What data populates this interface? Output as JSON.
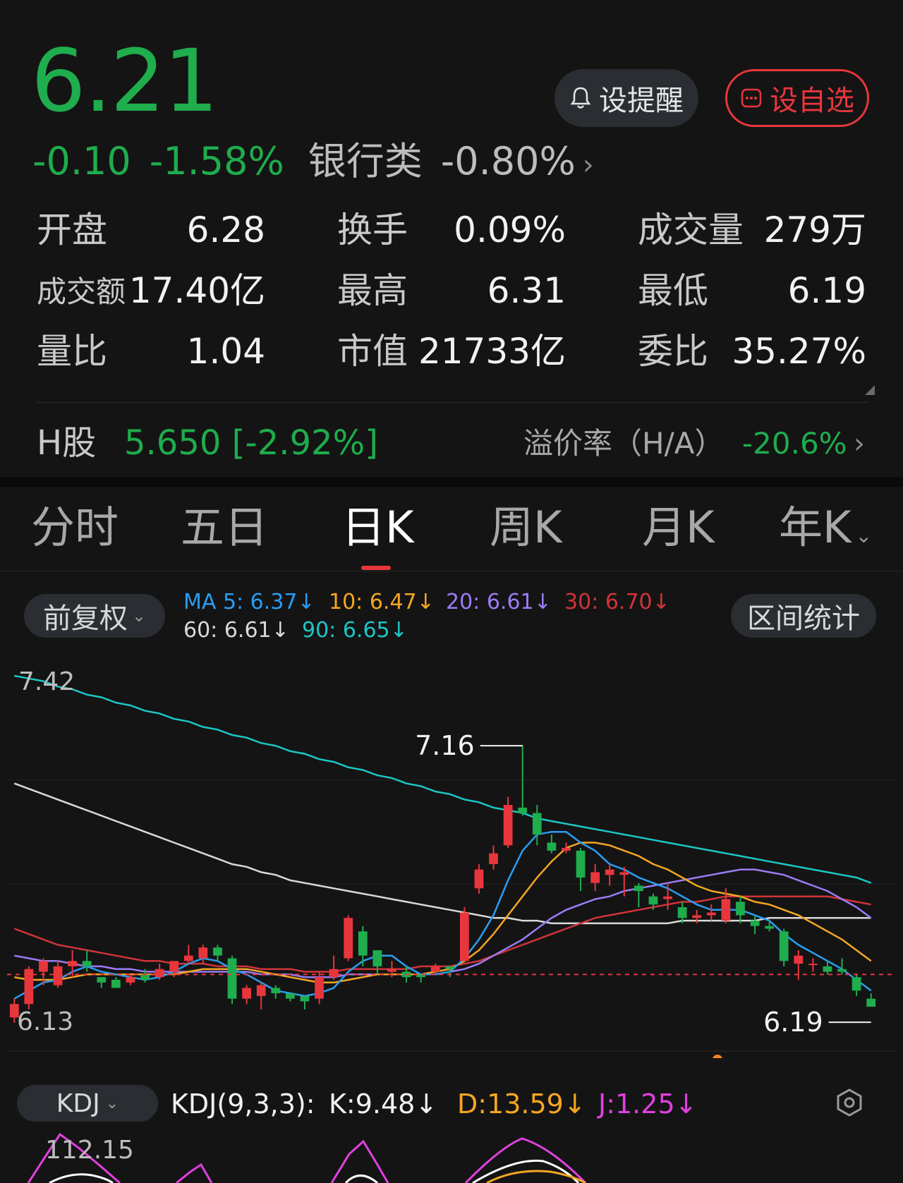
{
  "quote": {
    "price": "6.21",
    "change": "-0.10",
    "change_pct": "-1.58%",
    "sector_name": "银行类",
    "sector_change": "-0.80%",
    "remind_button": "设提醒",
    "watchlist_button": "设自选",
    "stats": {
      "open_label": "开盘",
      "open_value": "6.28",
      "turnover_label": "换手",
      "turnover_value": "0.09%",
      "volume_label": "成交量",
      "volume_value": "279万",
      "amount_label": "成交额",
      "amount_value": "17.40亿",
      "high_label": "最高",
      "high_value": "6.31",
      "low_label": "最低",
      "low_value": "6.19",
      "volume_ratio_label": "量比",
      "volume_ratio_value": "1.04",
      "market_cap_label": "市值",
      "market_cap_value": "21733亿",
      "order_ratio_label": "委比",
      "order_ratio_value": "35.27%"
    },
    "h_share": {
      "label": "H股",
      "value": "5.650 [-2.92%]",
      "premium_label": "溢价率（H/A）",
      "premium_value": "-20.6%"
    }
  },
  "tabs": [
    {
      "label": "分时",
      "active": false
    },
    {
      "label": "五日",
      "active": false
    },
    {
      "label": "日K",
      "active": true
    },
    {
      "label": "周K",
      "active": false
    },
    {
      "label": "月K",
      "active": false
    },
    {
      "label": "年K",
      "active": false
    }
  ],
  "chart_controls": {
    "adjust_label": "前复权",
    "range_stats_label": "区间统计"
  },
  "ma_legend": {
    "ma5": "MA 5: 6.37↓",
    "ma10": "10: 6.47↓",
    "ma20": "20: 6.61↓",
    "ma30": "30: 6.70↓",
    "ma60": "60: 6.61↓",
    "ma90": "90: 6.65↓"
  },
  "colors": {
    "up": "#e8363d",
    "down": "#1fad4d",
    "ma5": "#2a9df4",
    "ma10": "#f5a623",
    "ma20": "#9b7cf5",
    "ma30": "#d0343a",
    "ma60": "#d9d9d9",
    "ma90": "#1cc6c6",
    "kdj_k": "#ffffff",
    "kdj_d": "#f5a623",
    "kdj_j": "#e040e0"
  },
  "chart_data": {
    "type": "candlestick",
    "y_axis_top_label": "7.42",
    "y_axis_bottom_label": "6.13",
    "ylim": [
      6.13,
      7.42
    ],
    "max_marker": "7.16",
    "min_marker": "6.19",
    "reference_price": 6.31,
    "candles": [
      {
        "o": 6.15,
        "c": 6.2,
        "h": 6.22,
        "l": 6.13
      },
      {
        "o": 6.2,
        "c": 6.33,
        "h": 6.34,
        "l": 6.18
      },
      {
        "o": 6.32,
        "c": 6.36,
        "h": 6.37,
        "l": 6.27
      },
      {
        "o": 6.27,
        "c": 6.34,
        "h": 6.36,
        "l": 6.26
      },
      {
        "o": 6.34,
        "c": 6.36,
        "h": 6.4,
        "l": 6.3
      },
      {
        "o": 6.36,
        "c": 6.34,
        "h": 6.4,
        "l": 6.32
      },
      {
        "o": 6.3,
        "c": 6.28,
        "h": 6.3,
        "l": 6.26
      },
      {
        "o": 6.29,
        "c": 6.26,
        "h": 6.3,
        "l": 6.26
      },
      {
        "o": 6.28,
        "c": 6.3,
        "h": 6.31,
        "l": 6.27
      },
      {
        "o": 6.31,
        "c": 6.29,
        "h": 6.33,
        "l": 6.28
      },
      {
        "o": 6.3,
        "c": 6.33,
        "h": 6.35,
        "l": 6.29
      },
      {
        "o": 6.32,
        "c": 6.36,
        "h": 6.36,
        "l": 6.3
      },
      {
        "o": 6.36,
        "c": 6.38,
        "h": 6.42,
        "l": 6.35
      },
      {
        "o": 6.37,
        "c": 6.41,
        "h": 6.42,
        "l": 6.35
      },
      {
        "o": 6.41,
        "c": 6.38,
        "h": 6.42,
        "l": 6.36
      },
      {
        "o": 6.37,
        "c": 6.22,
        "h": 6.38,
        "l": 6.2
      },
      {
        "o": 6.22,
        "c": 6.26,
        "h": 6.27,
        "l": 6.2
      },
      {
        "o": 6.23,
        "c": 6.27,
        "h": 6.28,
        "l": 6.18
      },
      {
        "o": 6.26,
        "c": 6.24,
        "h": 6.27,
        "l": 6.22
      },
      {
        "o": 6.24,
        "c": 6.22,
        "h": 6.24,
        "l": 6.21
      },
      {
        "o": 6.23,
        "c": 6.21,
        "h": 6.23,
        "l": 6.18
      },
      {
        "o": 6.22,
        "c": 6.3,
        "h": 6.32,
        "l": 6.2
      },
      {
        "o": 6.3,
        "c": 6.33,
        "h": 6.38,
        "l": 6.29
      },
      {
        "o": 6.37,
        "c": 6.52,
        "h": 6.53,
        "l": 6.36
      },
      {
        "o": 6.47,
        "c": 6.38,
        "h": 6.49,
        "l": 6.34
      },
      {
        "o": 6.4,
        "c": 6.34,
        "h": 6.4,
        "l": 6.31
      },
      {
        "o": 6.32,
        "c": 6.33,
        "h": 6.36,
        "l": 6.3
      },
      {
        "o": 6.32,
        "c": 6.3,
        "h": 6.34,
        "l": 6.28
      },
      {
        "o": 6.31,
        "c": 6.3,
        "h": 6.31,
        "l": 6.28
      },
      {
        "o": 6.32,
        "c": 6.34,
        "h": 6.35,
        "l": 6.31
      },
      {
        "o": 6.34,
        "c": 6.33,
        "h": 6.34,
        "l": 6.3
      },
      {
        "o": 6.36,
        "c": 6.54,
        "h": 6.56,
        "l": 6.36
      },
      {
        "o": 6.63,
        "c": 6.7,
        "h": 6.72,
        "l": 6.61
      },
      {
        "o": 6.72,
        "c": 6.76,
        "h": 6.79,
        "l": 6.7
      },
      {
        "o": 6.79,
        "c": 6.94,
        "h": 6.97,
        "l": 6.78
      },
      {
        "o": 6.93,
        "c": 6.91,
        "h": 7.16,
        "l": 6.9
      },
      {
        "o": 6.91,
        "c": 6.83,
        "h": 6.94,
        "l": 6.79
      },
      {
        "o": 6.8,
        "c": 6.77,
        "h": 6.83,
        "l": 6.76
      },
      {
        "o": 6.77,
        "c": 6.78,
        "h": 6.8,
        "l": 6.76
      },
      {
        "o": 6.77,
        "c": 6.67,
        "h": 6.78,
        "l": 6.62
      },
      {
        "o": 6.65,
        "c": 6.69,
        "h": 6.72,
        "l": 6.62
      },
      {
        "o": 6.68,
        "c": 6.7,
        "h": 6.72,
        "l": 6.64
      },
      {
        "o": 6.68,
        "c": 6.69,
        "h": 6.71,
        "l": 6.6
      },
      {
        "o": 6.64,
        "c": 6.62,
        "h": 6.65,
        "l": 6.56
      },
      {
        "o": 6.6,
        "c": 6.57,
        "h": 6.61,
        "l": 6.55
      },
      {
        "o": 6.59,
        "c": 6.6,
        "h": 6.65,
        "l": 6.55
      },
      {
        "o": 6.56,
        "c": 6.52,
        "h": 6.58,
        "l": 6.5
      },
      {
        "o": 6.52,
        "c": 6.53,
        "h": 6.55,
        "l": 6.5
      },
      {
        "o": 6.53,
        "c": 6.54,
        "h": 6.57,
        "l": 6.51
      },
      {
        "o": 6.51,
        "c": 6.59,
        "h": 6.63,
        "l": 6.5
      },
      {
        "o": 6.58,
        "c": 6.53,
        "h": 6.6,
        "l": 6.5
      },
      {
        "o": 6.51,
        "c": 6.49,
        "h": 6.53,
        "l": 6.46
      },
      {
        "o": 6.49,
        "c": 6.48,
        "h": 6.51,
        "l": 6.47
      },
      {
        "o": 6.47,
        "c": 6.36,
        "h": 6.48,
        "l": 6.34
      },
      {
        "o": 6.35,
        "c": 6.38,
        "h": 6.4,
        "l": 6.29
      },
      {
        "o": 6.35,
        "c": 6.35,
        "h": 6.37,
        "l": 6.32
      },
      {
        "o": 6.34,
        "c": 6.32,
        "h": 6.36,
        "l": 6.31
      },
      {
        "o": 6.33,
        "c": 6.32,
        "h": 6.37,
        "l": 6.31
      },
      {
        "o": 6.3,
        "c": 6.25,
        "h": 6.31,
        "l": 6.23
      },
      {
        "o": 6.22,
        "c": 6.19,
        "h": 6.24,
        "l": 6.19
      }
    ],
    "ma5": [
      6.22,
      6.25,
      6.28,
      6.29,
      6.32,
      6.34,
      6.32,
      6.31,
      6.3,
      6.29,
      6.3,
      6.32,
      6.35,
      6.37,
      6.36,
      6.33,
      6.31,
      6.28,
      6.25,
      6.24,
      6.23,
      6.24,
      6.26,
      6.32,
      6.36,
      6.38,
      6.38,
      6.34,
      6.31,
      6.31,
      6.32,
      6.37,
      6.44,
      6.53,
      6.66,
      6.77,
      6.83,
      6.84,
      6.84,
      6.8,
      6.77,
      6.72,
      6.7,
      6.67,
      6.65,
      6.63,
      6.6,
      6.57,
      6.55,
      6.55,
      6.55,
      6.53,
      6.51,
      6.46,
      6.42,
      6.39,
      6.36,
      6.33,
      6.29,
      6.25
    ],
    "ma10": [
      6.3,
      6.29,
      6.29,
      6.29,
      6.3,
      6.31,
      6.31,
      6.31,
      6.31,
      6.31,
      6.31,
      6.31,
      6.32,
      6.33,
      6.33,
      6.33,
      6.33,
      6.32,
      6.31,
      6.3,
      6.29,
      6.28,
      6.28,
      6.29,
      6.3,
      6.31,
      6.31,
      6.31,
      6.31,
      6.32,
      6.33,
      6.36,
      6.4,
      6.46,
      6.53,
      6.6,
      6.67,
      6.73,
      6.78,
      6.8,
      6.8,
      6.79,
      6.77,
      6.75,
      6.72,
      6.7,
      6.67,
      6.64,
      6.62,
      6.61,
      6.6,
      6.58,
      6.57,
      6.55,
      6.53,
      6.5,
      6.47,
      6.44,
      6.4,
      6.36
    ],
    "ma20": [
      6.38,
      6.37,
      6.36,
      6.36,
      6.35,
      6.34,
      6.34,
      6.33,
      6.33,
      6.32,
      6.32,
      6.32,
      6.32,
      6.32,
      6.32,
      6.32,
      6.32,
      6.31,
      6.31,
      6.31,
      6.3,
      6.3,
      6.3,
      6.31,
      6.31,
      6.31,
      6.31,
      6.31,
      6.31,
      6.31,
      6.32,
      6.33,
      6.35,
      6.38,
      6.41,
      6.44,
      6.48,
      6.52,
      6.55,
      6.57,
      6.59,
      6.6,
      6.62,
      6.63,
      6.64,
      6.65,
      6.66,
      6.67,
      6.68,
      6.69,
      6.7,
      6.7,
      6.69,
      6.68,
      6.66,
      6.64,
      6.62,
      6.59,
      6.56,
      6.52
    ],
    "ma30": [
      6.48,
      6.46,
      6.44,
      6.42,
      6.41,
      6.4,
      6.39,
      6.38,
      6.37,
      6.36,
      6.36,
      6.35,
      6.35,
      6.35,
      6.34,
      6.34,
      6.34,
      6.33,
      6.33,
      6.33,
      6.32,
      6.32,
      6.32,
      6.33,
      6.33,
      6.33,
      6.33,
      6.33,
      6.34,
      6.34,
      6.34,
      6.35,
      6.36,
      6.38,
      6.4,
      6.42,
      6.44,
      6.46,
      6.48,
      6.5,
      6.52,
      6.53,
      6.54,
      6.55,
      6.56,
      6.57,
      6.58,
      6.58,
      6.59,
      6.6,
      6.6,
      6.6,
      6.6,
      6.6,
      6.6,
      6.6,
      6.6,
      6.59,
      6.58,
      6.57
    ],
    "ma60": [
      7.02,
      7.0,
      6.98,
      6.96,
      6.94,
      6.92,
      6.9,
      6.88,
      6.86,
      6.84,
      6.82,
      6.8,
      6.78,
      6.76,
      6.74,
      6.72,
      6.71,
      6.69,
      6.68,
      6.66,
      6.65,
      6.64,
      6.63,
      6.62,
      6.61,
      6.6,
      6.59,
      6.58,
      6.57,
      6.56,
      6.55,
      6.54,
      6.53,
      6.52,
      6.52,
      6.51,
      6.51,
      6.5,
      6.5,
      6.5,
      6.5,
      6.5,
      6.5,
      6.5,
      6.5,
      6.5,
      6.51,
      6.51,
      6.51,
      6.51,
      6.51,
      6.51,
      6.52,
      6.52,
      6.52,
      6.52,
      6.52,
      6.52,
      6.52,
      6.52
    ],
    "ma90": [
      7.42,
      7.41,
      7.4,
      7.38,
      7.37,
      7.35,
      7.34,
      7.32,
      7.31,
      7.29,
      7.28,
      7.26,
      7.25,
      7.23,
      7.22,
      7.2,
      7.19,
      7.17,
      7.16,
      7.14,
      7.13,
      7.11,
      7.1,
      7.08,
      7.07,
      7.05,
      7.04,
      7.02,
      7.01,
      6.99,
      6.98,
      6.96,
      6.95,
      6.93,
      6.92,
      6.91,
      6.89,
      6.88,
      6.87,
      6.86,
      6.85,
      6.84,
      6.83,
      6.82,
      6.81,
      6.8,
      6.79,
      6.78,
      6.77,
      6.76,
      6.75,
      6.74,
      6.73,
      6.72,
      6.71,
      6.7,
      6.69,
      6.68,
      6.67,
      6.65
    ]
  },
  "kdj": {
    "selector_label": "KDJ",
    "title": "KDJ(9,3,3):",
    "k": "K:9.48↓",
    "d": "D:13.59↓",
    "j": "J:1.25↓",
    "axis_top_label": "112.15"
  }
}
